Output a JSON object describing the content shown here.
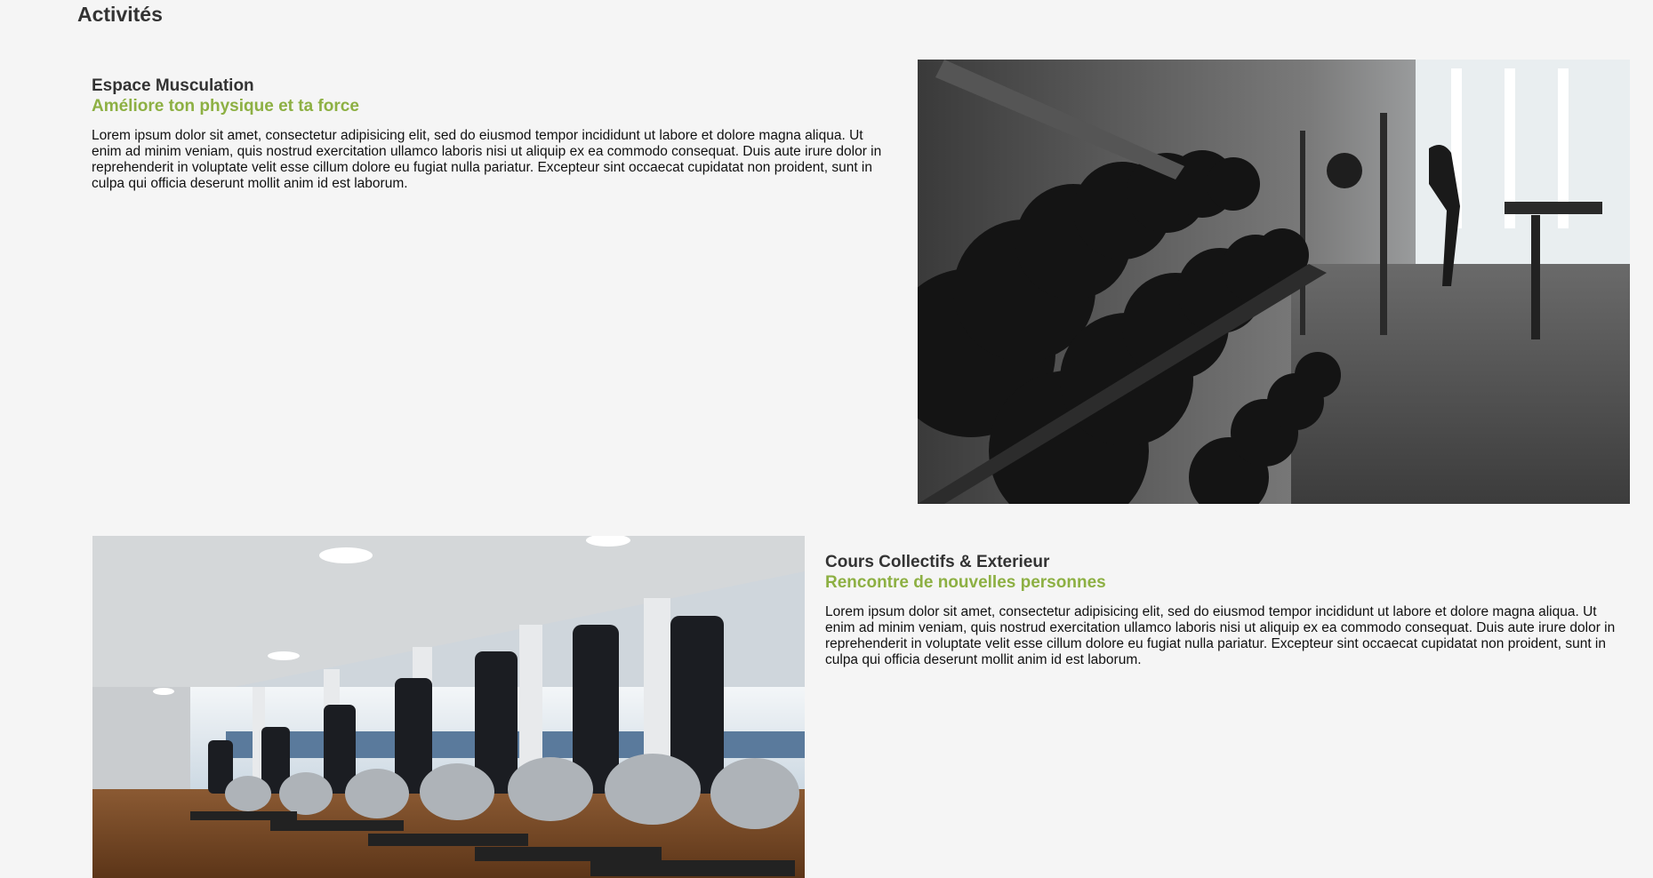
{
  "page": {
    "title": "Activités"
  },
  "activities": [
    {
      "title": "Espace Musculation",
      "subtitle": "Améliore ton physique et ta force",
      "body": "Lorem ipsum dolor sit amet, consectetur adipisicing elit, sed do eiusmod tempor incididunt ut labore et dolore magna aliqua. Ut enim ad minim veniam, quis nostrud exercitation ullamco laboris nisi ut aliquip ex ea commodo consequat. Duis aute irure dolor in reprehenderit in voluptate velit esse cillum dolore eu fugiat nulla pariatur. Excepteur sint occaecat cupidatat non proident, sunt in culpa qui officia deserunt mollit anim id est laborum.",
      "image": "gym-dumbbell-rack-photo"
    },
    {
      "title": "Cours Collectifs & Exterieur",
      "subtitle": "Rencontre de nouvelles personnes",
      "body": "Lorem ipsum dolor sit amet, consectetur adipisicing elit, sed do eiusmod tempor incididunt ut labore et dolore magna aliqua. Ut enim ad minim veniam, quis nostrud exercitation ullamco laboris nisi ut aliquip ex ea commodo consequat. Duis aute irure dolor in reprehenderit in voluptate velit esse cillum dolore eu fugiat nulla pariatur. Excepteur sint occaecat cupidatat non proident, sunt in culpa qui officia deserunt mollit anim id est laborum.",
      "image": "elliptical-machines-photo"
    }
  ],
  "colors": {
    "background": "#f5f5f5",
    "accent": "#8db043",
    "heading": "#333333"
  }
}
